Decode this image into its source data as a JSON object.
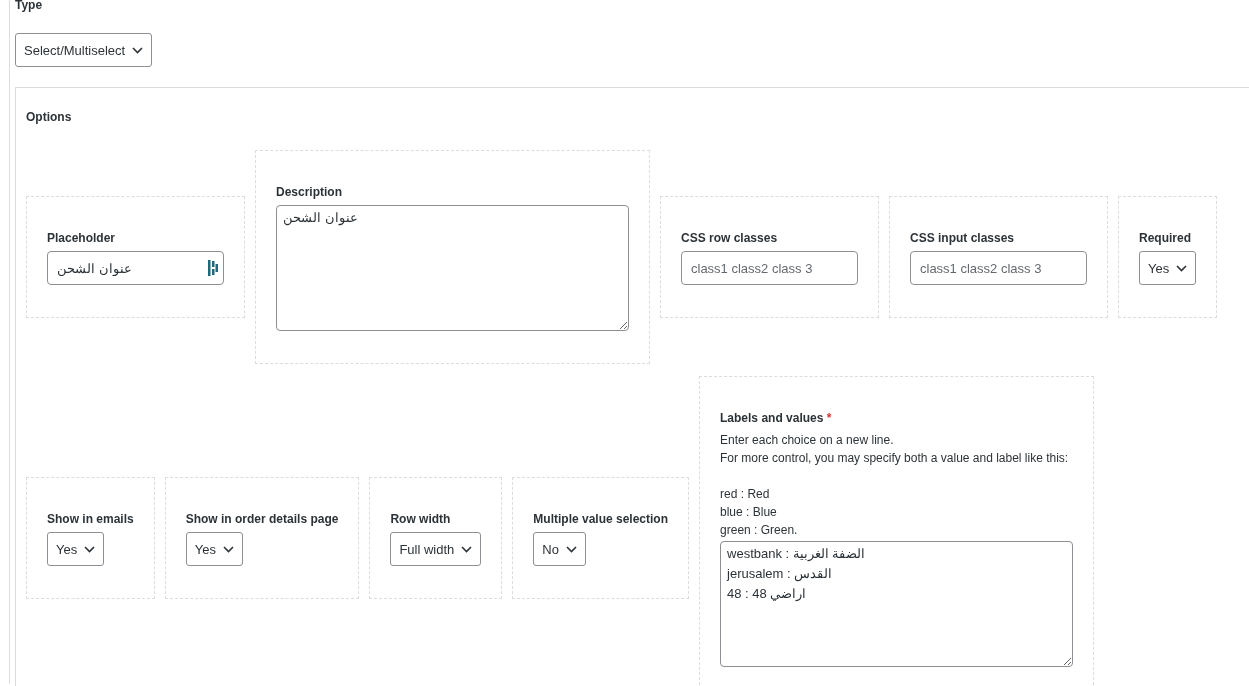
{
  "type": {
    "label": "Type",
    "value": "Select/Multiselect"
  },
  "options": {
    "title": "Options",
    "groups": [
      {
        "fields": [
          {
            "kind": "text",
            "label": "Placeholder",
            "value": "عنوان الشحن"
          },
          {
            "kind": "textarea",
            "label": "Description",
            "value": "عنوان الشحن"
          },
          {
            "kind": "text",
            "label": "CSS row classes",
            "placeholder": "class1 class2 class 3"
          },
          {
            "kind": "text",
            "label": "CSS input classes",
            "placeholder": "class1 class2 class 3"
          },
          {
            "kind": "select",
            "label": "Required",
            "value": "Yes"
          }
        ]
      },
      {
        "fields": [
          {
            "kind": "select",
            "label": "Show in emails",
            "value": "Yes"
          },
          {
            "kind": "select",
            "label": "Show in order details page",
            "value": "Yes"
          },
          {
            "kind": "select",
            "label": "Row width",
            "value": "Full width"
          },
          {
            "kind": "select",
            "label": "Multiple value selection",
            "value": "No"
          },
          {
            "kind": "textarea",
            "label": "Labels and values",
            "required": true,
            "required_mark": "*",
            "help": [
              "Enter each choice on a new line.",
              "For more control, you may specify both a value and label like this:"
            ],
            "examples": [
              "red : Red",
              "blue : Blue",
              "green : Green."
            ],
            "value": "westbank : الضفة الغربية\njerusalem : القدس\n48 : اراضي 48"
          }
        ]
      }
    ]
  }
}
